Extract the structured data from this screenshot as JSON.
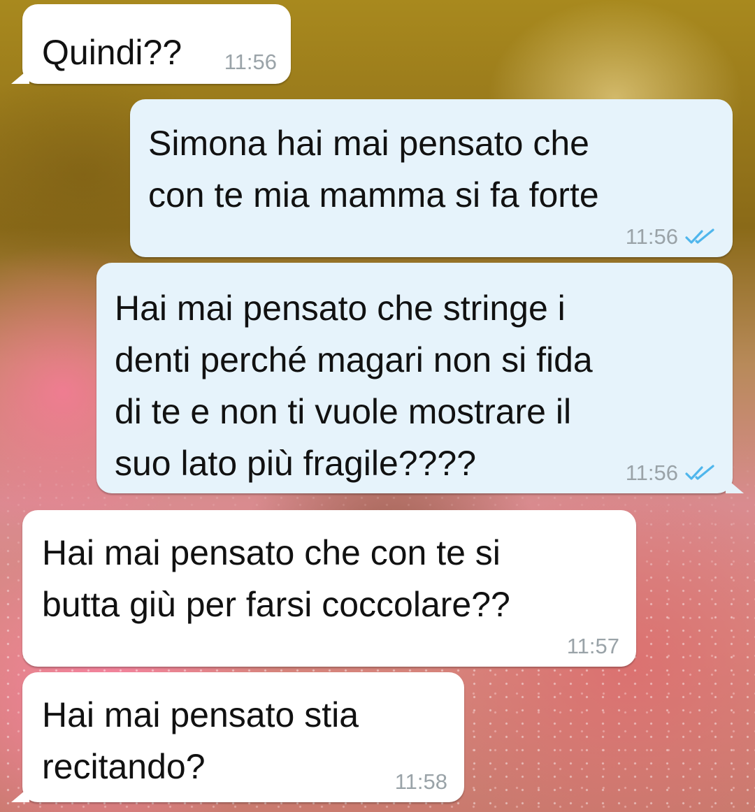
{
  "messages": [
    {
      "direction": "incoming",
      "text": "Quindi??",
      "time": "11:56"
    },
    {
      "direction": "outgoing",
      "text": "Simona hai mai pensato che\ncon te mia mamma si fa forte",
      "time": "11:56",
      "status_icon": "double-check-icon"
    },
    {
      "direction": "outgoing",
      "text": "Hai mai pensato che stringe i\ndenti perché magari non si fida\ndi te e non ti vuole mostrare il\nsuo lato più fragile????",
      "time": "11:56",
      "status_icon": "double-check-icon"
    },
    {
      "direction": "incoming",
      "text": "Hai mai pensato che con te si\nbutta giù per farsi coccolare??",
      "time": "11:57"
    },
    {
      "direction": "incoming",
      "text": "Hai mai pensato stia\nrecitando?",
      "time": "11:58"
    }
  ],
  "colors": {
    "incoming_bubble": "#ffffff",
    "outgoing_bubble": "#e6f3fb",
    "timestamp": "#9aa3a8",
    "read_tick": "#4fb6ec"
  }
}
